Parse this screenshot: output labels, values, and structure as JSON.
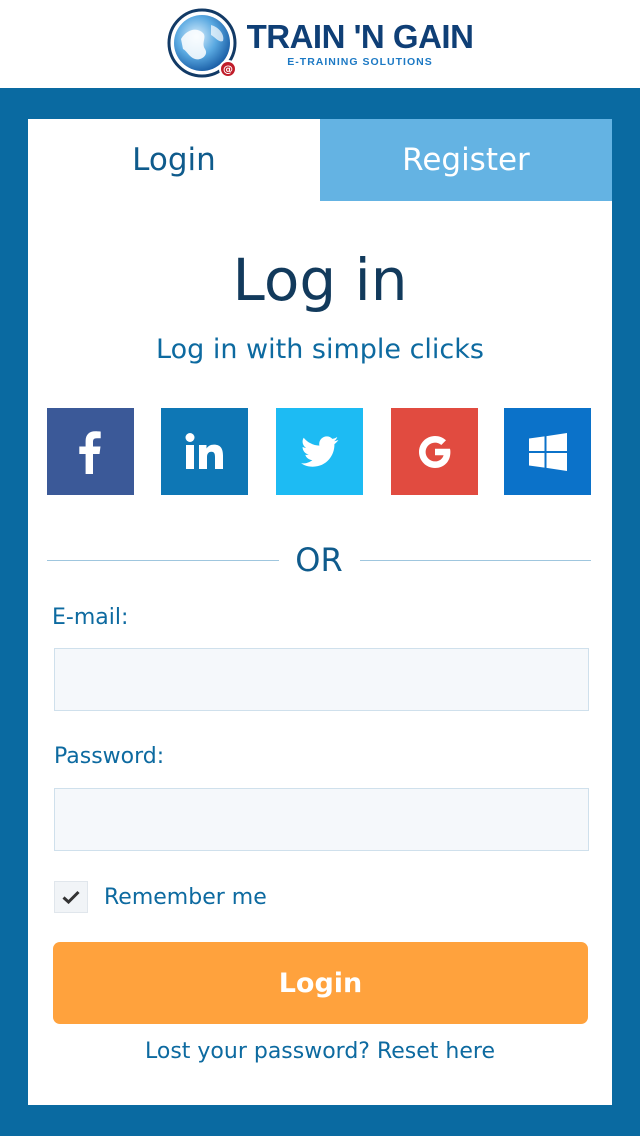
{
  "brand": {
    "title": "TRAIN 'N GAIN",
    "subtitle": "E-TRAINING SOLUTIONS",
    "logo_icon": "globe-at-icon"
  },
  "tabs": [
    {
      "label": "Login",
      "active": true
    },
    {
      "label": "Register",
      "active": false
    }
  ],
  "main": {
    "heading": "Log in",
    "subheading": "Log in with simple clicks",
    "or_text": "OR"
  },
  "social_buttons": [
    {
      "name": "facebook",
      "icon": "facebook-icon",
      "color": "#3b5998"
    },
    {
      "name": "linkedin",
      "icon": "linkedin-icon",
      "color": "#0e77b5"
    },
    {
      "name": "twitter",
      "icon": "twitter-icon",
      "color": "#1dbbf3"
    },
    {
      "name": "google",
      "icon": "google-icon",
      "color": "#e14b40"
    },
    {
      "name": "windows",
      "icon": "windows-icon",
      "color": "#0b72c9"
    }
  ],
  "form": {
    "email_label": "E-mail:",
    "email_value": "",
    "password_label": "Password:",
    "password_value": "",
    "remember_label": "Remember me",
    "remember_checked": true,
    "submit_label": "Login",
    "reset_text": "Lost your password? Reset here"
  },
  "colors": {
    "frame": "#0a6aa1",
    "tab_inactive": "#64b3e3",
    "accent": "#ffa23d",
    "text_primary": "#0d6aa0"
  }
}
